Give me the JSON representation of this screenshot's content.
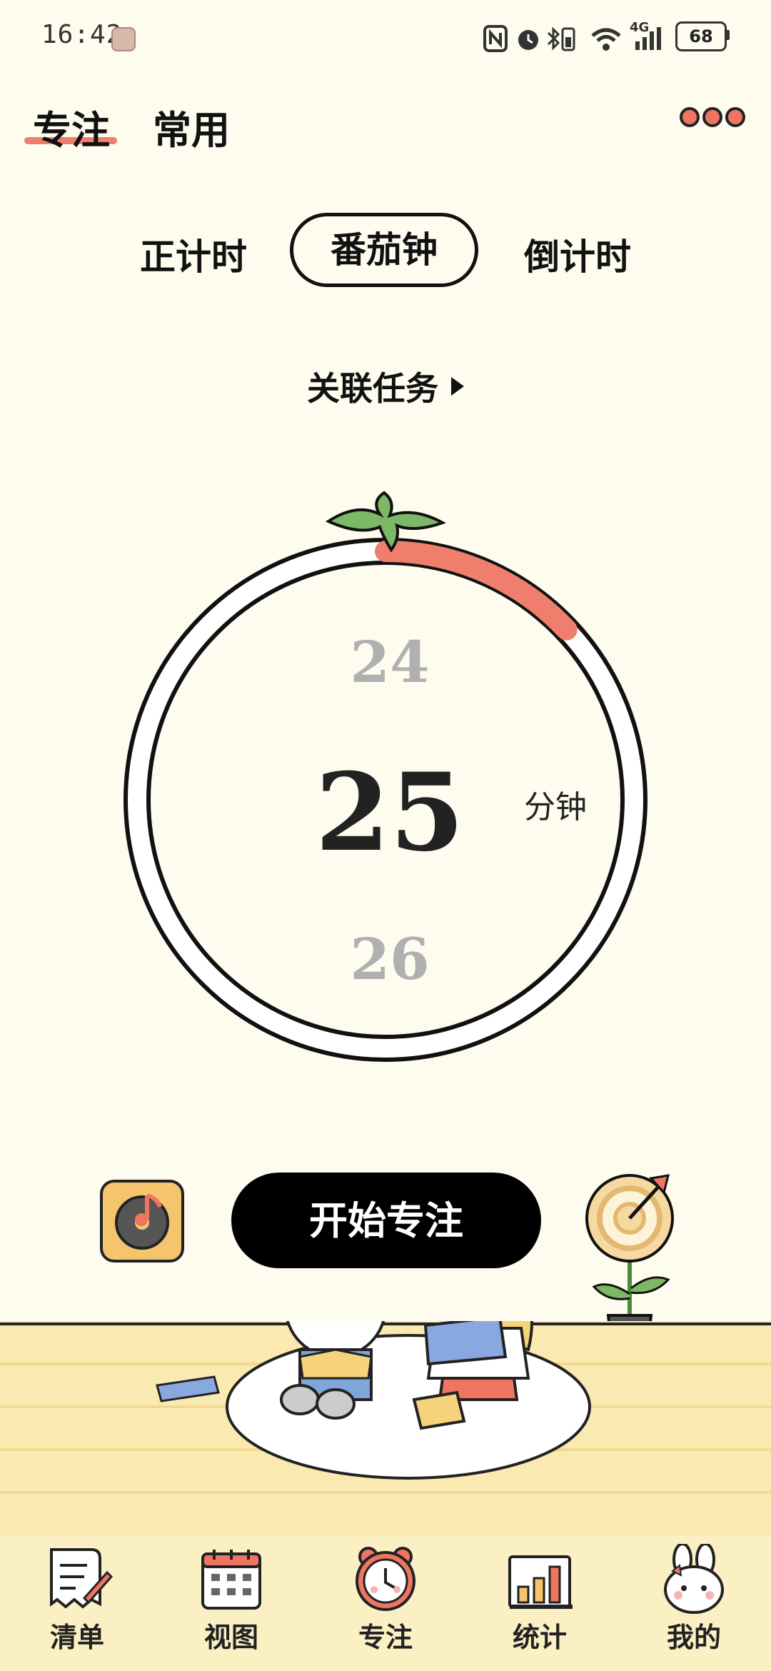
{
  "status_bar": {
    "time": "16:42",
    "battery": "68",
    "network_label": "4G"
  },
  "header": {
    "tabs": [
      {
        "label": "专注",
        "active": true
      },
      {
        "label": "常用",
        "active": false
      }
    ],
    "menu_icon": "more-dots-icon"
  },
  "modes": {
    "items": [
      "正计时",
      "番茄钟",
      "倒计时"
    ],
    "selected": "番茄钟"
  },
  "link_task": {
    "label": "关联任务"
  },
  "timer": {
    "prev_minutes": "24",
    "current_minutes": "25",
    "next_minutes": "26",
    "unit": "分钟",
    "ring_progress_fraction": 0.13,
    "accent_color": "#f07e6d"
  },
  "actions": {
    "start_label": "开始专注",
    "music_icon": "music-disc-icon",
    "target_icon": "dartboard-flower-icon"
  },
  "bottom_nav": {
    "items": [
      {
        "label": "清单",
        "icon": "list-note-icon"
      },
      {
        "label": "视图",
        "icon": "calendar-icon"
      },
      {
        "label": "专注",
        "icon": "alarm-clock-icon"
      },
      {
        "label": "统计",
        "icon": "bar-chart-icon"
      },
      {
        "label": "我的",
        "icon": "bunny-icon"
      }
    ],
    "active": "专注"
  },
  "colors": {
    "background": "#fdfcee",
    "accent": "#f07e6d",
    "primary_button": "#000000"
  }
}
